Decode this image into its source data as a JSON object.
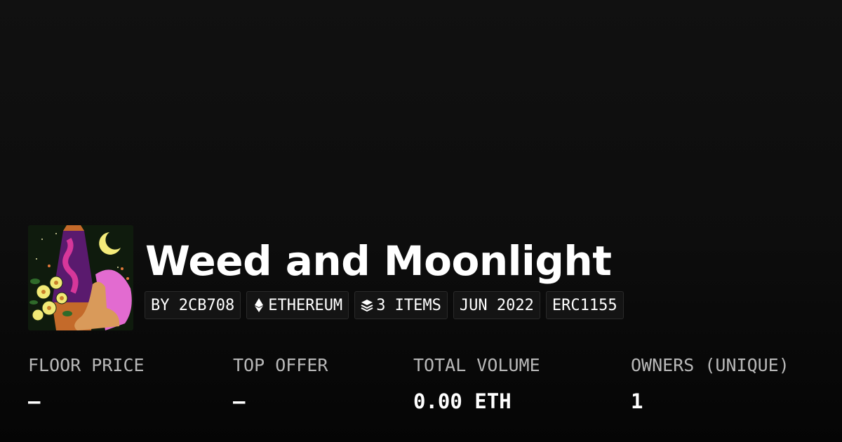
{
  "collection": {
    "name": "Weed and Moonlight",
    "thumbnail_alt": "collection-artwork"
  },
  "chips": {
    "creator": "BY 2CB708",
    "chain": "ETHEREUM",
    "chain_icon": "ethereum-icon",
    "items": "3 ITEMS",
    "items_icon": "layers-icon",
    "date": "JUN 2022",
    "standard": "ERC1155"
  },
  "stats": {
    "floor_price": {
      "label": "FLOOR PRICE",
      "value": "–"
    },
    "top_offer": {
      "label": "TOP OFFER",
      "value": "–"
    },
    "total_volume": {
      "label": "TOTAL VOLUME",
      "value": "0.00 ETH"
    },
    "owners": {
      "label": "OWNERS (UNIQUE)",
      "value": "1"
    }
  },
  "colors": {
    "background": "#0a0a0a",
    "text_primary": "#ffffff",
    "text_muted": "#b8b8b8",
    "chip_bg": "#141414"
  }
}
